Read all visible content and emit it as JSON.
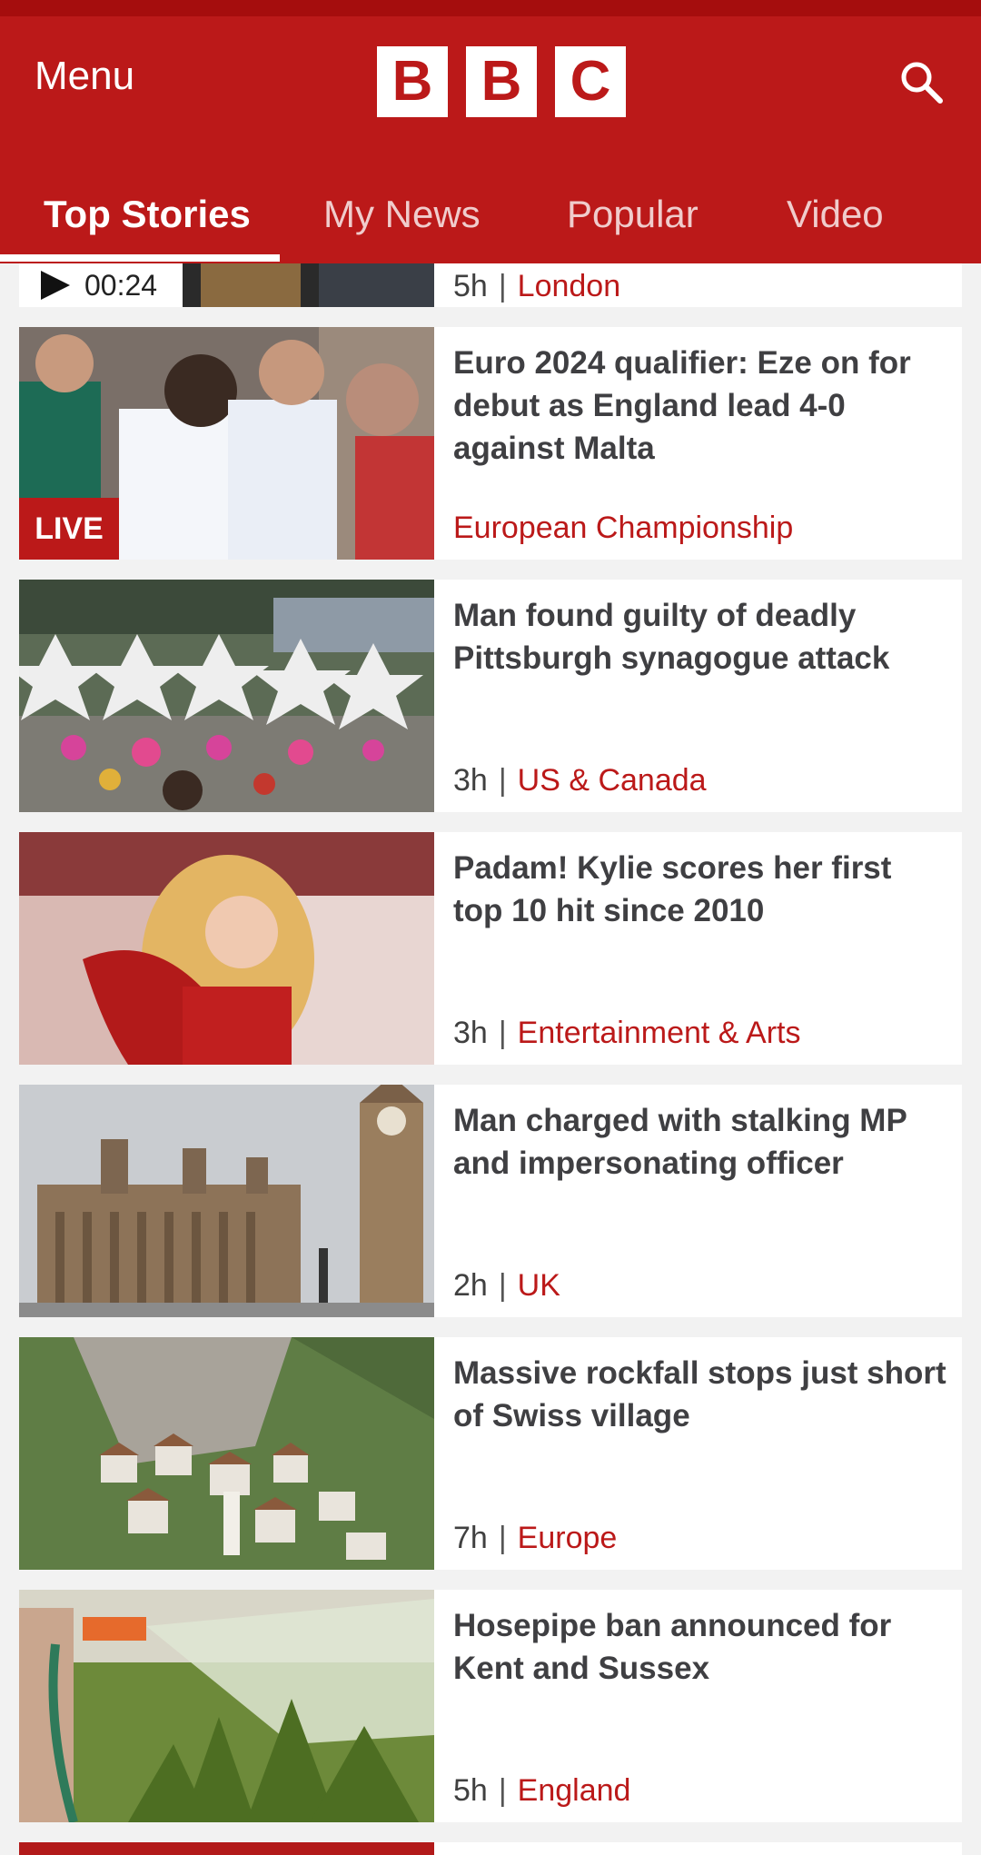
{
  "header": {
    "menu_label": "Menu",
    "logo": [
      "B",
      "B",
      "C"
    ],
    "search_icon": "search-icon",
    "brand_color": "#bb1919"
  },
  "tabs": [
    {
      "label": "Top Stories",
      "active": true
    },
    {
      "label": "My News",
      "active": false
    },
    {
      "label": "Popular",
      "active": false
    },
    {
      "label": "Video",
      "active": false
    }
  ],
  "partial_card": {
    "video_duration": "00:24",
    "time": "5h",
    "separator": "|",
    "tag": "London"
  },
  "stories": [
    {
      "headline": "Euro 2024 qualifier: Eze on for debut as England lead 4-0 against Malta",
      "badge": "LIVE",
      "time": "",
      "tag": "European Championship"
    },
    {
      "headline": "Man found guilty of deadly Pittsburgh synagogue attack",
      "time": "3h",
      "tag": "US & Canada"
    },
    {
      "headline": "Padam! Kylie scores her first top 10 hit since 2010",
      "time": "3h",
      "tag": "Entertainment & Arts"
    },
    {
      "headline": "Man charged with stalking MP and impersonating officer",
      "time": "2h",
      "tag": "UK"
    },
    {
      "headline": "Massive rockfall stops just short of Swiss village",
      "time": "7h",
      "tag": "Europe"
    },
    {
      "headline": "Hosepipe ban announced for Kent and Sussex",
      "time": "5h",
      "tag": "England"
    }
  ]
}
